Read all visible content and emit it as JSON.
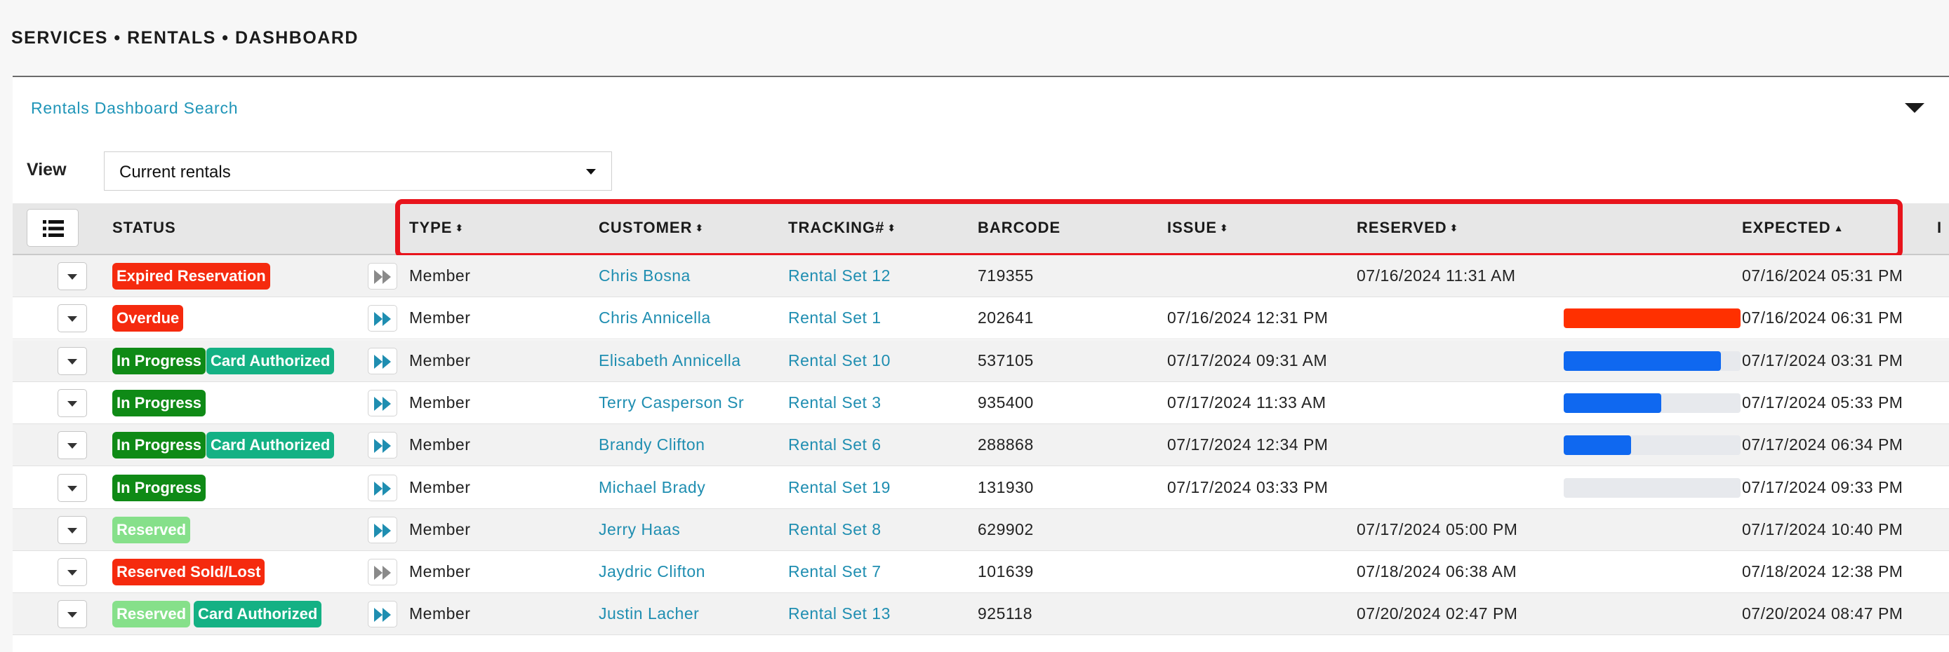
{
  "breadcrumb": "SERVICES • RENTALS • DASHBOARD",
  "search_panel": {
    "title": "Rentals Dashboard Search"
  },
  "view": {
    "label": "View",
    "selected": "Current rentals"
  },
  "columns": {
    "status": "STATUS",
    "type": "TYPE",
    "customer": "CUSTOMER",
    "tracking": "TRACKING#",
    "barcode": "BARCODE",
    "issue": "ISSUE",
    "reserved": "RESERVED",
    "expected": "EXPECTED",
    "overflow": "I"
  },
  "colors": {
    "link": "#1f8eb1",
    "badge_red": "#f52a0e",
    "badge_green": "#0f8a16",
    "badge_teal": "#14b184",
    "badge_light_green": "#86e08a",
    "progress_red": "#ff3000",
    "progress_blue": "#0f68f0",
    "highlight": "#e8141c"
  },
  "rows": [
    {
      "badges": [
        {
          "text": "Expired Reservation",
          "color": "red"
        }
      ],
      "forward_active": false,
      "type": "Member",
      "customer": "Chris Bosna",
      "tracking": "Rental Set 12",
      "barcode": "719355",
      "issue": "",
      "reserved": "07/16/2024 11:31 AM",
      "progress": null,
      "expected": "07/16/2024 05:31 PM"
    },
    {
      "badges": [
        {
          "text": "Overdue",
          "color": "red"
        }
      ],
      "forward_active": true,
      "type": "Member",
      "customer": "Chris Annicella",
      "tracking": "Rental Set 1",
      "barcode": "202641",
      "issue": "07/16/2024 12:31 PM",
      "reserved": "",
      "progress": {
        "value": 1.0,
        "color": "red"
      },
      "expected": "07/16/2024 06:31 PM"
    },
    {
      "badges": [
        {
          "text": "In Progress",
          "color": "green"
        },
        {
          "text": "Card Authorized",
          "color": "teal"
        }
      ],
      "forward_active": true,
      "type": "Member",
      "customer": "Elisabeth Annicella",
      "tracking": "Rental Set 10",
      "barcode": "537105",
      "issue": "07/17/2024 09:31 AM",
      "reserved": "",
      "progress": {
        "value": 0.89,
        "color": "blue"
      },
      "expected": "07/17/2024 03:31 PM"
    },
    {
      "badges": [
        {
          "text": "In Progress",
          "color": "green"
        }
      ],
      "forward_active": true,
      "type": "Member",
      "customer": "Terry Casperson Sr",
      "tracking": "Rental Set 3",
      "barcode": "935400",
      "issue": "07/17/2024 11:33 AM",
      "reserved": "",
      "progress": {
        "value": 0.55,
        "color": "blue"
      },
      "expected": "07/17/2024 05:33 PM"
    },
    {
      "badges": [
        {
          "text": "In Progress",
          "color": "green"
        },
        {
          "text": "Card Authorized",
          "color": "teal"
        }
      ],
      "forward_active": true,
      "type": "Member",
      "customer": "Brandy Clifton",
      "tracking": "Rental Set 6",
      "barcode": "288868",
      "issue": "07/17/2024 12:34 PM",
      "reserved": "",
      "progress": {
        "value": 0.38,
        "color": "blue"
      },
      "expected": "07/17/2024 06:34 PM"
    },
    {
      "badges": [
        {
          "text": "In Progress",
          "color": "green"
        }
      ],
      "forward_active": true,
      "type": "Member",
      "customer": "Michael Brady",
      "tracking": "Rental Set 19",
      "barcode": "131930",
      "issue": "07/17/2024 03:33 PM",
      "reserved": "",
      "progress": {
        "value": 0.0,
        "color": "blue"
      },
      "expected": "07/17/2024 09:33 PM"
    },
    {
      "badges": [
        {
          "text": "Reserved",
          "color": "light"
        }
      ],
      "forward_active": true,
      "type": "Member",
      "customer": "Jerry Haas",
      "tracking": "Rental Set 8",
      "barcode": "629902",
      "issue": "",
      "reserved": "07/17/2024 05:00 PM",
      "progress": null,
      "expected": "07/17/2024 10:40 PM"
    },
    {
      "badges": [
        {
          "text": "Reserved Sold/Lost",
          "color": "red"
        }
      ],
      "forward_active": false,
      "type": "Member",
      "customer": "Jaydric Clifton",
      "tracking": "Rental Set 7",
      "barcode": "101639",
      "issue": "",
      "reserved": "07/18/2024 06:38 AM",
      "progress": null,
      "expected": "07/18/2024 12:38 PM"
    },
    {
      "badges": [
        {
          "text": "Reserved",
          "color": "light"
        },
        {
          "text": "Card Authorized",
          "color": "teal"
        }
      ],
      "forward_active": true,
      "type": "Member",
      "customer": "Justin Lacher",
      "tracking": "Rental Set 13",
      "barcode": "925118",
      "issue": "",
      "reserved": "07/20/2024 02:47 PM",
      "progress": null,
      "expected": "07/20/2024 08:47 PM"
    }
  ]
}
